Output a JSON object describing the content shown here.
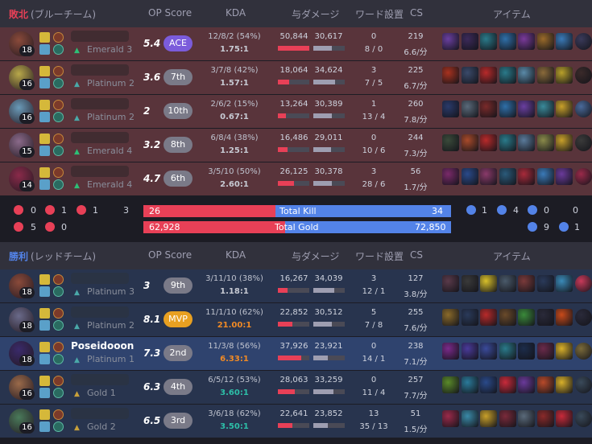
{
  "headers": {
    "loss": {
      "result": "敗北",
      "team": " (ブルーチーム)"
    },
    "win": {
      "result": "勝利",
      "team": " (レッドチーム)"
    },
    "cols": {
      "op": "OP Score",
      "kda": "KDA",
      "dmg": "与ダメージ",
      "ward": "ワード設置",
      "cs": "CS",
      "items": "アイテム"
    }
  },
  "colors": {
    "loss": "#e84057",
    "win": "#5383e8",
    "dealt_bar": "#e84057",
    "taken_bar": "#9e9eb1",
    "ace": "#7b5cdb",
    "mvp": "#e8a021"
  },
  "loss_team": [
    {
      "level": "18",
      "name": "",
      "tier": "Emerald 3",
      "op": "5.4",
      "rank": "ACE",
      "kda_line": "12/8/2 (54%)",
      "kda_ratio": "1.75:1",
      "dealt": "50,844",
      "taken": "30,617",
      "dealt_frac": 1.0,
      "taken_frac": 0.6,
      "wards": "0",
      "wards2": "8 / 0",
      "cs": "219",
      "cs_min": "6.6/分"
    },
    {
      "level": "16",
      "name": "",
      "tier": "Platinum 2",
      "op": "3.6",
      "rank": "7th",
      "kda_line": "3/7/8 (42%)",
      "kda_ratio": "1.57:1",
      "dealt": "18,064",
      "taken": "34,624",
      "dealt_frac": 0.36,
      "taken_frac": 0.68,
      "wards": "3",
      "wards2": "7 / 5",
      "cs": "225",
      "cs_min": "6.7/分"
    },
    {
      "level": "16",
      "name": "",
      "tier": "Platinum 2",
      "op": "2",
      "rank": "10th",
      "kda_line": "2/6/2 (15%)",
      "kda_ratio": "0.67:1",
      "dealt": "13,264",
      "taken": "30,389",
      "dealt_frac": 0.26,
      "taken_frac": 0.6,
      "wards": "1",
      "wards2": "13 / 4",
      "cs": "260",
      "cs_min": "7.8/分"
    },
    {
      "level": "15",
      "name": "",
      "tier": "Emerald 4",
      "op": "3.2",
      "rank": "8th",
      "kda_line": "6/8/4 (38%)",
      "kda_ratio": "1.25:1",
      "dealt": "16,486",
      "taken": "29,011",
      "dealt_frac": 0.32,
      "taken_frac": 0.57,
      "wards": "0",
      "wards2": "10 / 6",
      "cs": "244",
      "cs_min": "7.3/分"
    },
    {
      "level": "14",
      "name": "",
      "tier": "Emerald 4",
      "op": "4.7",
      "rank": "6th",
      "kda_line": "3/5/10 (50%)",
      "kda_ratio": "2.60:1",
      "dealt": "26,125",
      "taken": "30,378",
      "dealt_frac": 0.51,
      "taken_frac": 0.6,
      "wards": "3",
      "wards2": "28 / 6",
      "cs": "56",
      "cs_min": "1.7/分"
    }
  ],
  "summary": {
    "left_objectives": [
      "0",
      "1",
      "1",
      "3",
      "5",
      "0"
    ],
    "right_objectives": [
      "1",
      "4",
      "0",
      "0",
      "9",
      "1"
    ],
    "kills_loss": "26",
    "kills_label": "Total Kill",
    "kills_win": "34",
    "kills_loss_frac": 0.43,
    "gold_loss": "62,928",
    "gold_label": "Total Gold",
    "gold_win": "72,850",
    "gold_loss_frac": 0.46
  },
  "win_team": [
    {
      "level": "18",
      "name": "",
      "tier": "Platinum 3",
      "op": "3",
      "rank": "9th",
      "kda_line": "3/11/10 (38%)",
      "kda_ratio": "1.18:1",
      "dealt": "16,267",
      "taken": "34,039",
      "dealt_frac": 0.32,
      "taken_frac": 0.67,
      "wards": "3",
      "wards2": "12 / 1",
      "cs": "127",
      "cs_min": "3.8/分",
      "ratio_style": "normal"
    },
    {
      "level": "18",
      "name": "",
      "tier": "Platinum 2",
      "op": "8.1",
      "rank": "MVP",
      "kda_line": "11/1/10 (62%)",
      "kda_ratio": "21.00:1",
      "dealt": "22,852",
      "taken": "30,512",
      "dealt_frac": 0.45,
      "taken_frac": 0.6,
      "wards": "5",
      "wards2": "7 / 8",
      "cs": "255",
      "cs_min": "7.6/分",
      "ratio_style": "gold"
    },
    {
      "level": "18",
      "name": "Poseidooon",
      "tier": "Platinum 1",
      "op": "7.3",
      "rank": "2nd",
      "kda_line": "11/3/8 (56%)",
      "kda_ratio": "6.33:1",
      "dealt": "37,926",
      "taken": "23,921",
      "dealt_frac": 0.75,
      "taken_frac": 0.47,
      "wards": "0",
      "wards2": "14 / 1",
      "cs": "238",
      "cs_min": "7.1/分",
      "ratio_style": "gold"
    },
    {
      "level": "16",
      "name": "",
      "tier": "Gold 1",
      "op": "6.3",
      "rank": "4th",
      "kda_line": "6/5/12 (53%)",
      "kda_ratio": "3.60:1",
      "dealt": "28,063",
      "taken": "33,259",
      "dealt_frac": 0.55,
      "taken_frac": 0.65,
      "wards": "0",
      "wards2": "11 / 4",
      "cs": "257",
      "cs_min": "7.7/分",
      "ratio_style": "teal"
    },
    {
      "level": "16",
      "name": "",
      "tier": "Gold 2",
      "op": "6.5",
      "rank": "3rd",
      "kda_line": "3/6/18 (62%)",
      "kda_ratio": "3.50:1",
      "dealt": "22,641",
      "taken": "23,852",
      "dealt_frac": 0.45,
      "taken_frac": 0.47,
      "wards": "13",
      "wards2": "35 / 13",
      "cs": "51",
      "cs_min": "1.5/分",
      "ratio_style": "teal"
    }
  ]
}
